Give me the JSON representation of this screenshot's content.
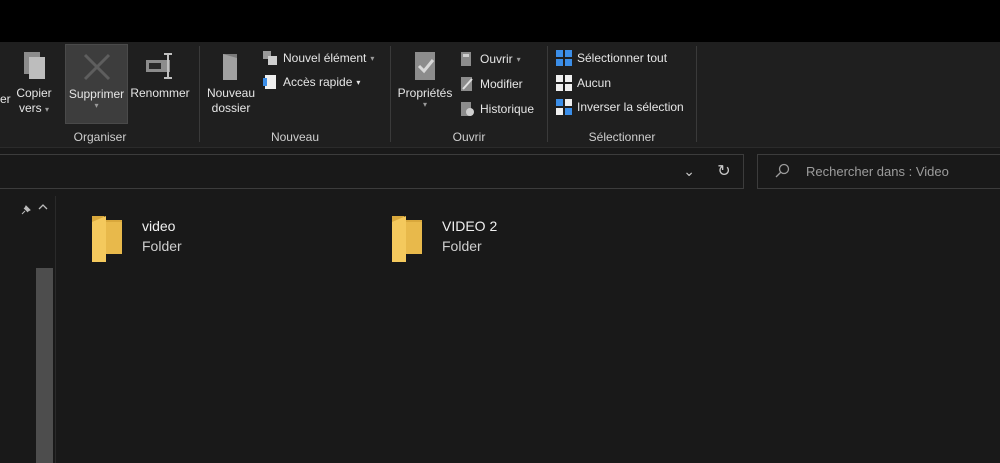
{
  "ribbon": {
    "organiser": {
      "label": "Organiser",
      "move_partial": "er",
      "copy_line1": "Copier",
      "copy_line2": "vers",
      "delete": "Supprimer",
      "rename": "Renommer"
    },
    "nouveau": {
      "label": "Nouveau",
      "new_folder_line1": "Nouveau",
      "new_folder_line2": "dossier",
      "new_item": "Nouvel élément",
      "quick_access": "Accès rapide"
    },
    "ouvrir": {
      "label": "Ouvrir",
      "properties": "Propriétés",
      "open": "Ouvrir",
      "edit": "Modifier",
      "history": "Historique"
    },
    "selectionner": {
      "label": "Sélectionner",
      "select_all": "Sélectionner tout",
      "none": "Aucun",
      "invert": "Inverser la sélection"
    }
  },
  "address": {
    "chevron": "⌄",
    "refresh": "↻"
  },
  "search": {
    "placeholder": "Rechercher dans : Video"
  },
  "items": [
    {
      "name": "video",
      "type": "Folder"
    },
    {
      "name": "VIDEO 2",
      "type": "Folder"
    }
  ],
  "icons": {
    "folder": "folder-icon",
    "pin": "pin-icon"
  },
  "colors": {
    "background": "#191919",
    "ribbon": "#1f1f1f",
    "folder": "#f2c55c",
    "accent": "#4aa3ff"
  }
}
